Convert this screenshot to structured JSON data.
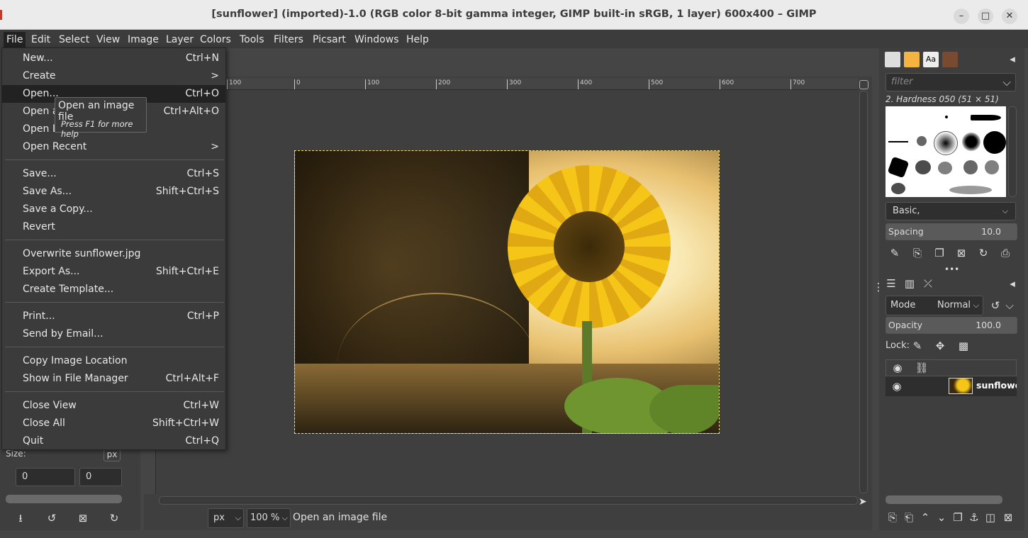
{
  "window": {
    "title": "[sunflower] (imported)-1.0 (RGB color 8-bit gamma integer, GIMP built-in sRGB, 1 layer) 600x400 – GIMP",
    "minimize": "–",
    "maximize": "□",
    "close": "✕"
  },
  "menubar": [
    "File",
    "Edit",
    "Select",
    "View",
    "Image",
    "Layer",
    "Colors",
    "Tools",
    "Filters",
    "Picsart",
    "Windows",
    "Help"
  ],
  "file_menu": {
    "items": [
      {
        "label": "New...",
        "accel": "Ctrl+N"
      },
      {
        "label": "Create",
        "accel": ">"
      },
      {
        "label": "Open...",
        "accel": "Ctrl+O"
      },
      {
        "label": "Open a",
        "accel": "Ctrl+Alt+O"
      },
      {
        "label": "Open L",
        "accel": ""
      },
      {
        "label": "Open Recent",
        "accel": ">"
      },
      {
        "label": "Save...",
        "accel": "Ctrl+S"
      },
      {
        "label": "Save As...",
        "accel": "Shift+Ctrl+S"
      },
      {
        "label": "Save a Copy...",
        "accel": ""
      },
      {
        "label": "Revert",
        "accel": ""
      },
      {
        "label": "Overwrite sunflower.jpg",
        "accel": ""
      },
      {
        "label": "Export As...",
        "accel": "Shift+Ctrl+E"
      },
      {
        "label": "Create Template...",
        "accel": ""
      },
      {
        "label": "Print...",
        "accel": "Ctrl+P"
      },
      {
        "label": "Send by Email...",
        "accel": ""
      },
      {
        "label": "Copy Image Location",
        "accel": ""
      },
      {
        "label": "Show in File Manager",
        "accel": "Ctrl+Alt+F"
      },
      {
        "label": "Close View",
        "accel": "Ctrl+W"
      },
      {
        "label": "Close All",
        "accel": "Shift+Ctrl+W"
      },
      {
        "label": "Quit",
        "accel": "Ctrl+Q"
      }
    ]
  },
  "tooltip": {
    "title": "Open an image file",
    "hint": "Press F1 for more help"
  },
  "ruler": {
    "ticks": [
      "100",
      "0",
      "100",
      "200",
      "300",
      "400",
      "500",
      "600",
      "700"
    ]
  },
  "toolbox": {
    "size_label": "Size:",
    "unit": "px",
    "width_value": "0",
    "height_value": "0"
  },
  "status": {
    "unit": "px",
    "zoom": "100 %",
    "message": "Open an image file"
  },
  "brushes": {
    "filter_placeholder": "filter",
    "brush_name": "2. Hardness 050 (51 × 51)",
    "brush_set": "Basic,",
    "spacing_label": "Spacing",
    "spacing_value": "10.0"
  },
  "layers": {
    "mode_label": "Mode",
    "mode_value": "Normal",
    "opacity_label": "Opacity",
    "opacity_value": "100.0",
    "lock_label": "Lock:",
    "layer_name": "sunflower.jpg"
  }
}
